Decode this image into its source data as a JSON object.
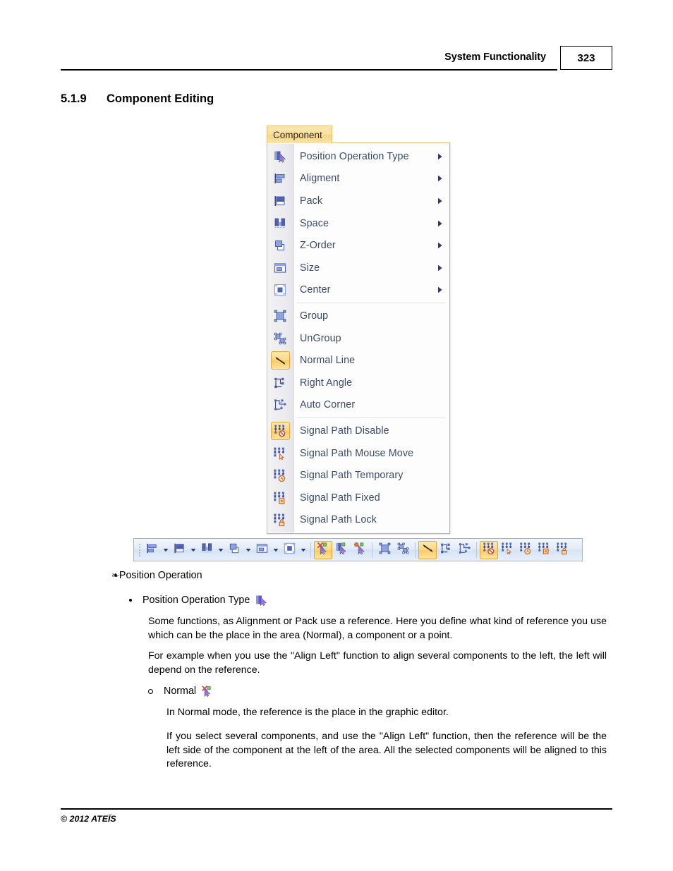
{
  "header": {
    "title": "System Functionality",
    "page_number": "323"
  },
  "section": {
    "number": "5.1.9",
    "title": "Component Editing"
  },
  "menu": {
    "tab_label": "Component",
    "items": [
      {
        "label": "Position Operation Type",
        "icon": "position-operation-type-icon",
        "submenu": true,
        "selected": false,
        "separator_after": false
      },
      {
        "label": "Aligment",
        "icon": "alignment-icon",
        "submenu": true,
        "selected": false,
        "separator_after": false
      },
      {
        "label": "Pack",
        "icon": "pack-icon",
        "submenu": true,
        "selected": false,
        "separator_after": false
      },
      {
        "label": "Space",
        "icon": "space-icon",
        "submenu": true,
        "selected": false,
        "separator_after": false
      },
      {
        "label": "Z-Order",
        "icon": "z-order-icon",
        "submenu": true,
        "selected": false,
        "separator_after": false
      },
      {
        "label": "Size",
        "icon": "size-icon",
        "submenu": true,
        "selected": false,
        "separator_after": false
      },
      {
        "label": "Center",
        "icon": "center-icon",
        "submenu": true,
        "selected": false,
        "separator_after": true
      },
      {
        "label": "Group",
        "icon": "group-icon",
        "submenu": false,
        "selected": false,
        "separator_after": false
      },
      {
        "label": "UnGroup",
        "icon": "ungroup-icon",
        "submenu": false,
        "selected": false,
        "separator_after": false
      },
      {
        "label": "Normal Line",
        "icon": "normal-line-icon",
        "submenu": false,
        "selected": true,
        "separator_after": false
      },
      {
        "label": "Right Angle",
        "icon": "right-angle-icon",
        "submenu": false,
        "selected": false,
        "separator_after": false
      },
      {
        "label": "Auto Corner",
        "icon": "auto-corner-icon",
        "submenu": false,
        "selected": false,
        "separator_after": true
      },
      {
        "label": "Signal Path Disable",
        "icon": "signal-path-disable-icon",
        "submenu": false,
        "selected": true,
        "separator_after": false
      },
      {
        "label": "Signal Path Mouse Move",
        "icon": "signal-path-mouse-move-icon",
        "submenu": false,
        "selected": false,
        "separator_after": false
      },
      {
        "label": "Signal Path Temporary",
        "icon": "signal-path-temporary-icon",
        "submenu": false,
        "selected": false,
        "separator_after": false
      },
      {
        "label": "Signal Path Fixed",
        "icon": "signal-path-fixed-icon",
        "submenu": false,
        "selected": false,
        "separator_after": false
      },
      {
        "label": "Signal Path Lock",
        "icon": "signal-path-lock-icon",
        "submenu": false,
        "selected": false,
        "separator_after": false
      }
    ],
    "colors": {
      "tab_background": "#fbdd95",
      "panel_background": "#fdfdfd",
      "gutter_background": "#ebebef",
      "label_text": "#3b4a6b",
      "selection_highlight": "#fbd882",
      "selection_border": "#e0a93a"
    }
  },
  "toolbar": {
    "groups": [
      {
        "buttons": [
          {
            "name": "alignment-icon",
            "dropdown": true,
            "selected": false
          },
          {
            "name": "pack-icon",
            "dropdown": true,
            "selected": false
          },
          {
            "name": "space-icon",
            "dropdown": true,
            "selected": false
          },
          {
            "name": "z-order-icon",
            "dropdown": true,
            "selected": false
          },
          {
            "name": "size-icon",
            "dropdown": true,
            "selected": false
          },
          {
            "name": "center-icon",
            "dropdown": true,
            "selected": false
          }
        ]
      },
      {
        "buttons": [
          {
            "name": "position-normal-icon",
            "dropdown": false,
            "selected": true
          },
          {
            "name": "position-component-icon",
            "dropdown": false,
            "selected": false
          },
          {
            "name": "position-point-icon",
            "dropdown": false,
            "selected": false
          }
        ]
      },
      {
        "buttons": [
          {
            "name": "group-icon",
            "dropdown": false,
            "selected": false
          },
          {
            "name": "ungroup-icon",
            "dropdown": false,
            "selected": false
          }
        ]
      },
      {
        "buttons": [
          {
            "name": "normal-line-icon",
            "dropdown": false,
            "selected": true
          },
          {
            "name": "right-angle-icon",
            "dropdown": false,
            "selected": false
          },
          {
            "name": "auto-corner-icon",
            "dropdown": false,
            "selected": false
          }
        ]
      },
      {
        "buttons": [
          {
            "name": "signal-path-disable-icon",
            "dropdown": false,
            "selected": true
          },
          {
            "name": "signal-path-mouse-move-icon",
            "dropdown": false,
            "selected": false
          },
          {
            "name": "signal-path-temporary-icon",
            "dropdown": false,
            "selected": false
          },
          {
            "name": "signal-path-fixed-icon",
            "dropdown": false,
            "selected": false
          },
          {
            "name": "signal-path-lock-icon",
            "dropdown": false,
            "selected": false
          }
        ]
      }
    ]
  },
  "content": {
    "heading_position_operation": "Position Operation",
    "bullet_position_operation_type": "Position Operation Type",
    "para_reference": "Some functions, as Alignment or Pack use a reference. Here you define what kind of reference you use which can be the place in the area (Normal), a component or a point.",
    "para_example": "For example when you use the \"Align Left\" function to align several components to the left, the left will depend on the reference.",
    "bullet_normal": "Normal",
    "para_normal_mode": "In Normal mode, the reference is the place in the graphic editor.",
    "para_select_several": "If you select several components, and use the \"Align Left\" function, then the reference will be the left side of the component at the left of the area. All the selected components will be aligned to this reference."
  },
  "footer": {
    "copyright": "© 2012 ATEÏS"
  }
}
